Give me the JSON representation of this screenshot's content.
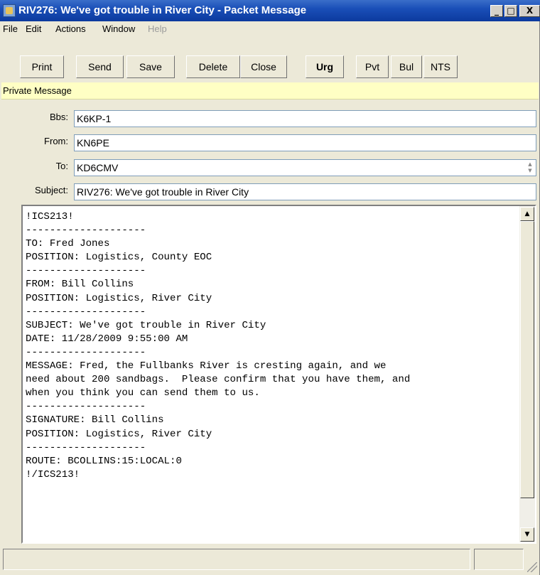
{
  "window": {
    "title": "RIV276: We've got trouble in River City - Packet Message",
    "controls": {
      "minimize": "_",
      "maximize": "□",
      "close": "X"
    }
  },
  "menu": {
    "items": [
      {
        "label": "File",
        "enabled": true
      },
      {
        "label": "Edit",
        "enabled": true
      },
      {
        "label": "Actions",
        "enabled": true
      },
      {
        "label": "Window",
        "enabled": true
      },
      {
        "label": "Help",
        "enabled": false
      }
    ]
  },
  "toolbar": {
    "buttons": [
      "Print",
      "Send",
      "Save",
      "Delete",
      "Close",
      "Urg",
      "Pvt",
      "Bul",
      "NTS"
    ]
  },
  "banner": {
    "text": "Private Message",
    "color": "#ffffc4"
  },
  "fields": {
    "bbs": {
      "label": "Bbs:",
      "value": "K6KP-1"
    },
    "from": {
      "label": "From:",
      "value": "KN6PE"
    },
    "to": {
      "label": "To:",
      "value": "KD6CMV"
    },
    "subject": {
      "label": "Subject:",
      "value": "RIV276: We've got trouble in River City"
    }
  },
  "message_body": "!ICS213!\n--------------------\nTO: Fred Jones\nPOSITION: Logistics, County EOC\n--------------------\nFROM: Bill Collins\nPOSITION: Logistics, River City\n--------------------\nSUBJECT: We've got trouble in River City\nDATE: 11/28/2009 9:55:00 AM\n--------------------\nMESSAGE: Fred, the Fullbanks River is cresting again, and we\nneed about 200 sandbags.  Please confirm that you have them, and\nwhen you think you can send them to us.\n--------------------\nSIGNATURE: Bill Collins\nPOSITION: Logistics, River City\n--------------------\nROUTE: BCOLLINS:15:LOCAL:0\n!/ICS213!",
  "scrollbar": {
    "up_icon": "▲",
    "down_icon": "▼"
  },
  "colors": {
    "title_bar": "#0c3a9e",
    "window_face": "#ece9d8"
  }
}
